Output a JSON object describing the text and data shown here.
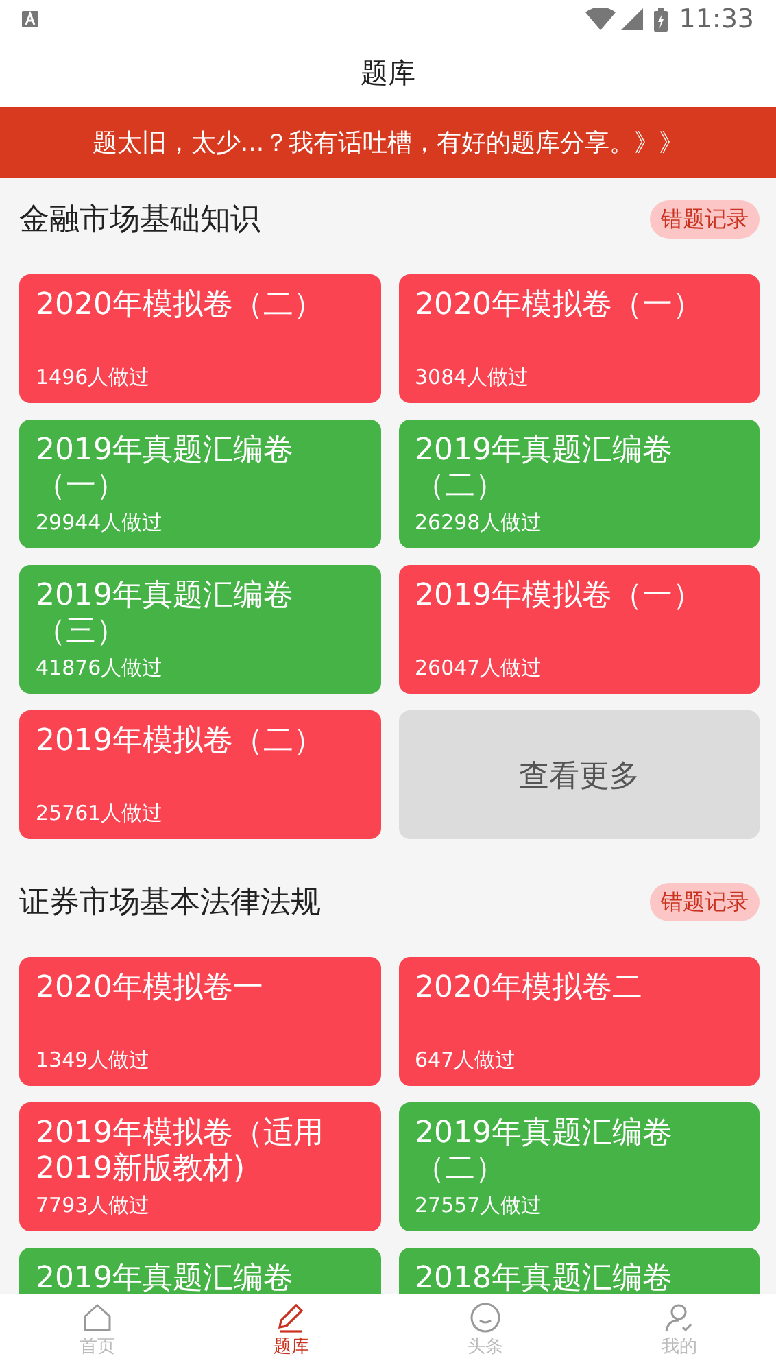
{
  "status_bar": {
    "time": "11:33"
  },
  "header": {
    "title": "题库"
  },
  "banner": {
    "text": "题太旧，太少...？我有话吐槽，有好的题库分享。》》"
  },
  "sections": [
    {
      "title": "金融市场基础知识",
      "action": "错题记录",
      "cards": [
        {
          "kind": "paper",
          "color": "#fb4452",
          "title": "2020年模拟卷（二）",
          "count": "1496人做过"
        },
        {
          "kind": "paper",
          "color": "#fb4452",
          "title": "2020年模拟卷（一）",
          "count": "3084人做过"
        },
        {
          "kind": "paper",
          "color": "#45b345",
          "title": "2019年真题汇编卷（一）",
          "count": "29944人做过"
        },
        {
          "kind": "paper",
          "color": "#45b345",
          "title": "2019年真题汇编卷（二）",
          "count": "26298人做过"
        },
        {
          "kind": "paper",
          "color": "#45b345",
          "title": "2019年真题汇编卷（三）",
          "count": "41876人做过"
        },
        {
          "kind": "paper",
          "color": "#fb4452",
          "title": "2019年模拟卷（一）",
          "count": "26047人做过"
        },
        {
          "kind": "paper",
          "color": "#fb4452",
          "title": "2019年模拟卷（二）",
          "count": "25761人做过"
        },
        {
          "kind": "more",
          "title": "查看更多"
        }
      ]
    },
    {
      "title": "证券市场基本法律法规",
      "action": "错题记录",
      "cards": [
        {
          "kind": "paper",
          "color": "#fb4452",
          "title": "2020年模拟卷一",
          "count": "1349人做过"
        },
        {
          "kind": "paper",
          "color": "#fb4452",
          "title": "2020年模拟卷二",
          "count": "647人做过"
        },
        {
          "kind": "paper",
          "color": "#fb4452",
          "title": "2019年模拟卷（适用2019新版教材)",
          "count": "7793人做过"
        },
        {
          "kind": "paper",
          "color": "#45b345",
          "title": "2019年真题汇编卷（二）",
          "count": "27557人做过"
        },
        {
          "kind": "paper",
          "color": "#45b345",
          "title": "2019年真题汇编卷"
        },
        {
          "kind": "paper",
          "color": "#45b345",
          "title": "2018年真题汇编卷"
        }
      ]
    }
  ],
  "tabs": [
    {
      "label": "首页",
      "selected": false
    },
    {
      "label": "题库",
      "selected": true
    },
    {
      "label": "头条",
      "selected": false
    },
    {
      "label": "我的",
      "selected": false
    }
  ]
}
